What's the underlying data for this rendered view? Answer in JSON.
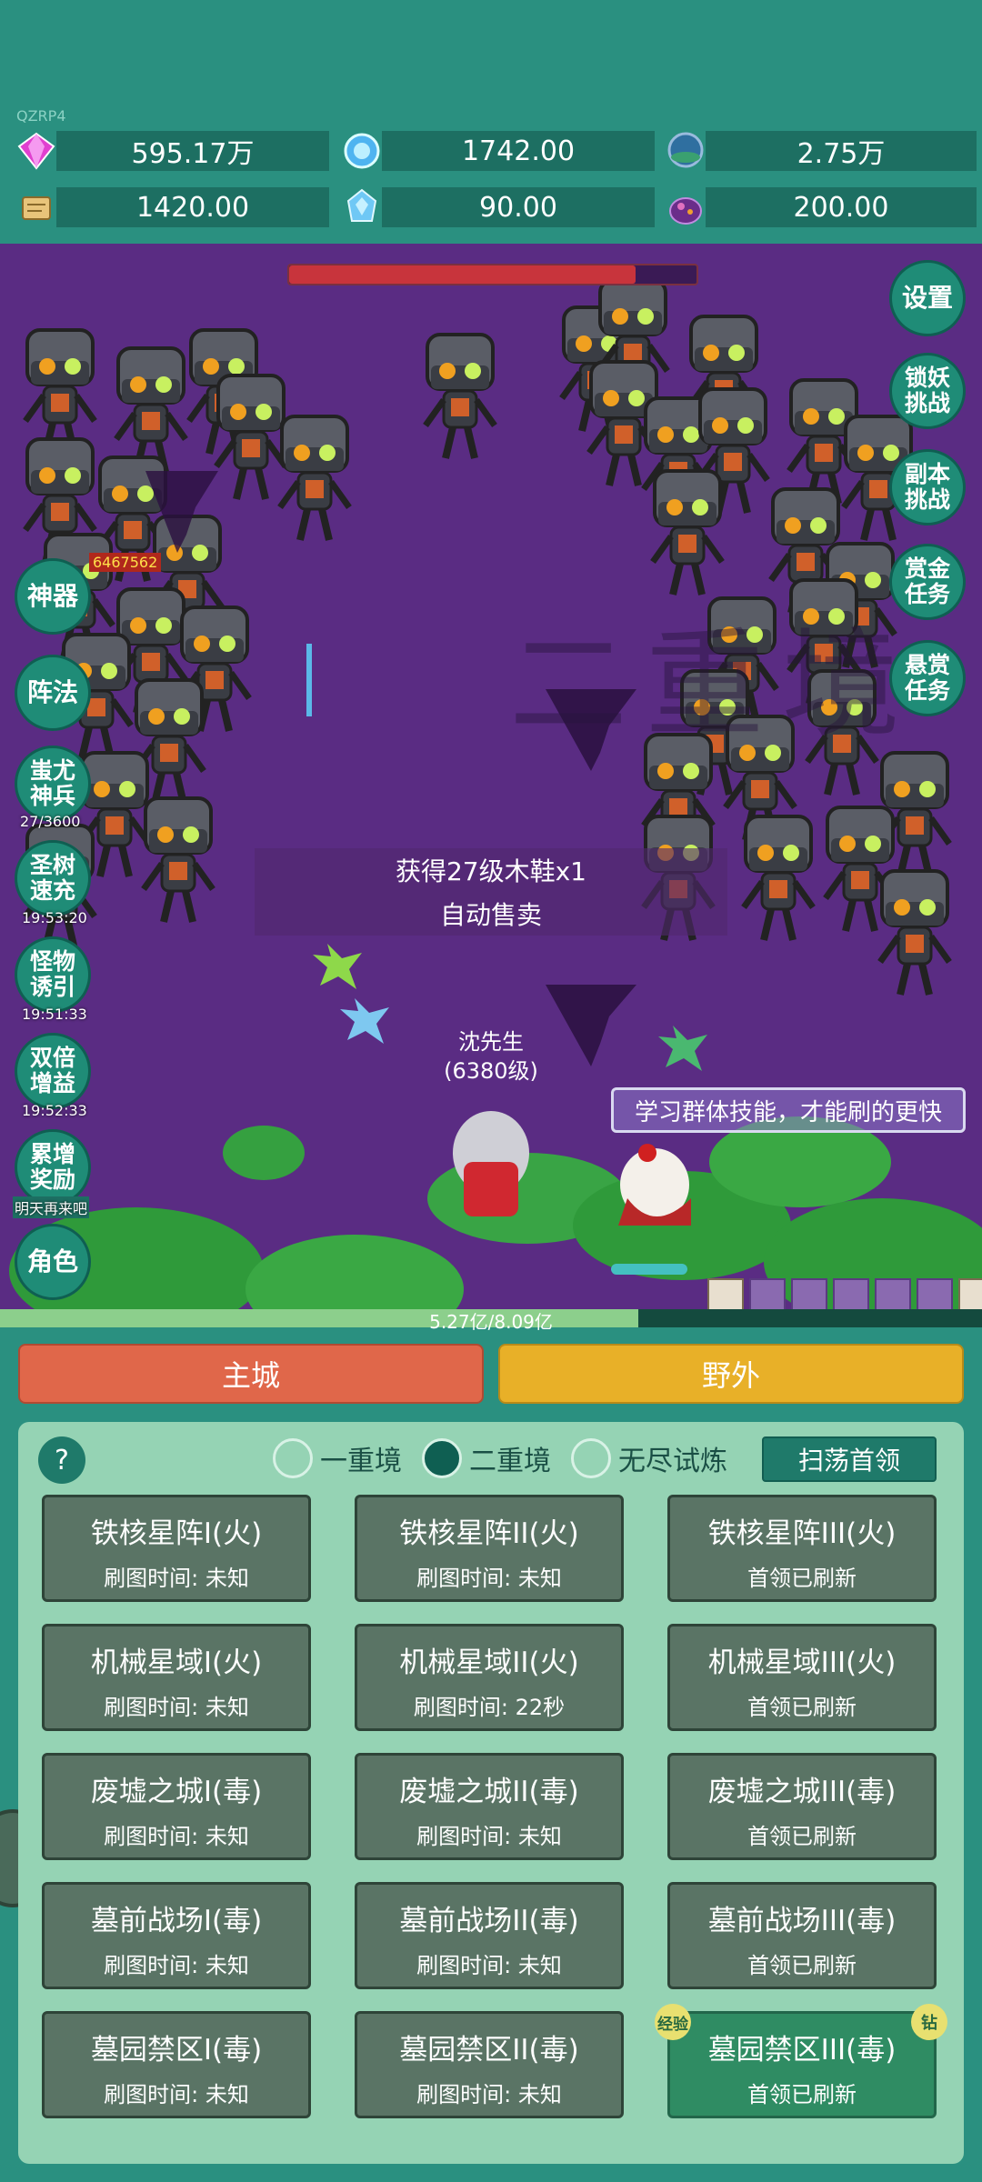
{
  "tag": "QZRP4",
  "resources": [
    {
      "icon": "diamond-icon",
      "value": "595.17万"
    },
    {
      "icon": "blue-gem-icon",
      "value": "1742.00"
    },
    {
      "icon": "crystal-orb-icon",
      "value": "2.75万"
    },
    {
      "icon": "scroll-icon",
      "value": "1420.00"
    },
    {
      "icon": "ice-crystal-icon",
      "value": "90.00"
    },
    {
      "icon": "purple-pot-icon",
      "value": "200.00"
    }
  ],
  "battle": {
    "damage": "6467562",
    "watermark": "二重境",
    "notice": "获得27级木鞋x1",
    "notice2": "自动售卖",
    "player_name": "沈先生",
    "player_level": "(6380级)",
    "tip": "学习群体技能，才能刷的更快",
    "boss_hp_fraction": 0.85,
    "exp_fraction": 0.65,
    "exp_text": "5.27亿/8.09亿"
  },
  "right_buttons": [
    "设置",
    "锁妖挑战",
    "副本挑战",
    "赏金任务",
    "悬赏任务"
  ],
  "left_buttons": [
    {
      "label": "神器",
      "timer": ""
    },
    {
      "label": "阵法",
      "timer": ""
    },
    {
      "label": "蚩尤神兵",
      "timer": "27/3600"
    },
    {
      "label": "圣树速充",
      "timer": "19:53:20"
    },
    {
      "label": "怪物诱引",
      "timer": "19:51:33"
    },
    {
      "label": "双倍增益",
      "timer": "19:52:33"
    },
    {
      "label": "累增奖励",
      "timer": "明天再来吧"
    },
    {
      "label": "角色",
      "timer": ""
    }
  ],
  "nav": {
    "city": "主城",
    "wild": "野外"
  },
  "panel": {
    "help": "?",
    "modes": [
      "一重境",
      "二重境",
      "无尽试炼"
    ],
    "selected_mode": 1,
    "sweep_button": "扫荡首领",
    "badge_exp": "经验",
    "badge_diamond": "钻",
    "maps": [
      [
        {
          "name": "铁核星阵I(火)",
          "status": "刷图时间: 未知"
        },
        {
          "name": "铁核星阵II(火)",
          "status": "刷图时间: 未知"
        },
        {
          "name": "铁核星阵III(火)",
          "status": "首领已刷新"
        }
      ],
      [
        {
          "name": "机械星域I(火)",
          "status": "刷图时间: 未知"
        },
        {
          "name": "机械星域II(火)",
          "status": "刷图时间: 22秒"
        },
        {
          "name": "机械星域III(火)",
          "status": "首领已刷新"
        }
      ],
      [
        {
          "name": "废墟之城I(毒)",
          "status": "刷图时间: 未知"
        },
        {
          "name": "废墟之城II(毒)",
          "status": "刷图时间: 未知"
        },
        {
          "name": "废墟之城III(毒)",
          "status": "首领已刷新"
        }
      ],
      [
        {
          "name": "墓前战场I(毒)",
          "status": "刷图时间: 未知"
        },
        {
          "name": "墓前战场II(毒)",
          "status": "刷图时间: 未知"
        },
        {
          "name": "墓前战场III(毒)",
          "status": "首领已刷新"
        }
      ],
      [
        {
          "name": "墓园禁区I(毒)",
          "status": "刷图时间: 未知"
        },
        {
          "name": "墓园禁区II(毒)",
          "status": "刷图时间: 未知"
        },
        {
          "name": "墓园禁区III(毒)",
          "status": "首领已刷新"
        }
      ]
    ]
  }
}
